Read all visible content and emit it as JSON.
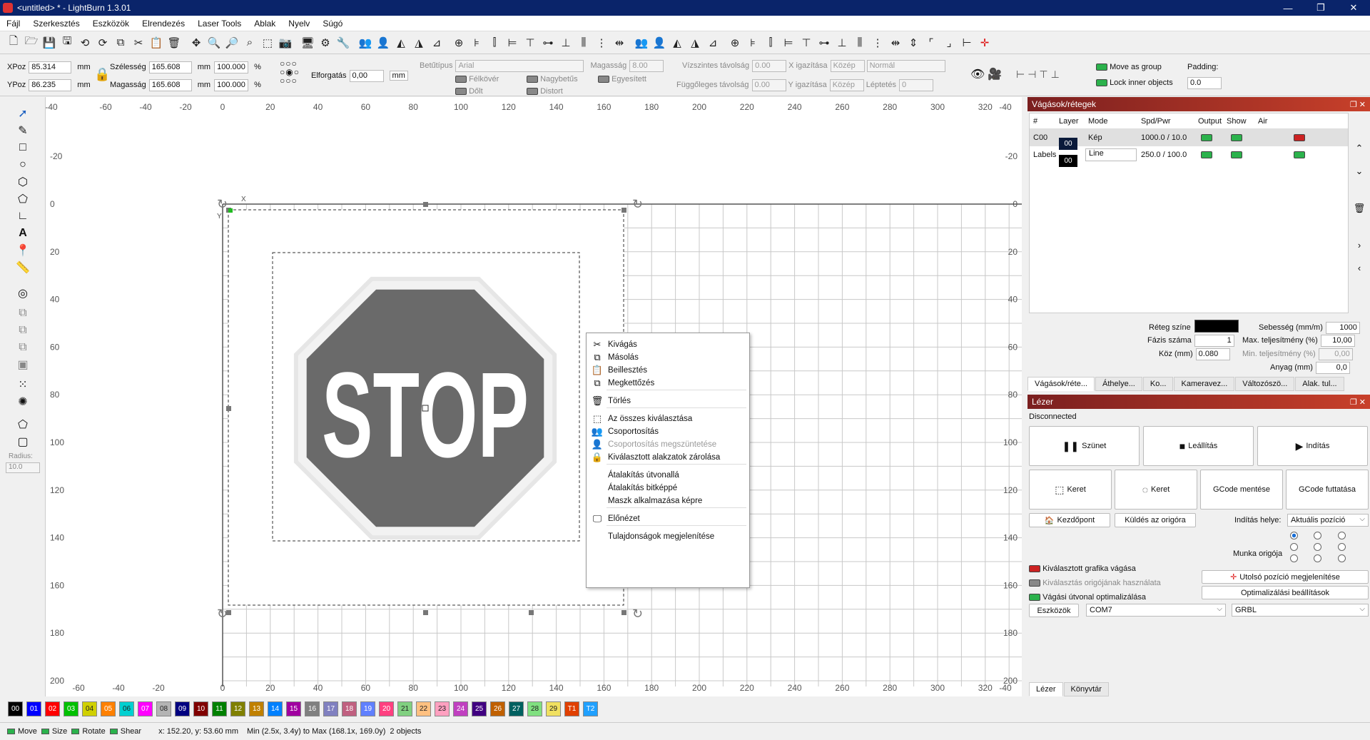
{
  "window": {
    "title": "<untitled> * - LightBurn 1.3.01"
  },
  "menu": [
    "Fájl",
    "Szerkesztés",
    "Eszközök",
    "Elrendezés",
    "Laser Tools",
    "Ablak",
    "Nyelv",
    "Súgó"
  ],
  "props": {
    "xpos_label": "XPoz",
    "xpos": "85.314",
    "ypos_label": "YPoz",
    "ypos": "86.235",
    "unit": "mm",
    "width_label": "Szélesség",
    "width": "165.608",
    "height_label": "Magasság",
    "height": "165.608",
    "scale_w": "100.000",
    "scale_h": "100.000",
    "pct": "%",
    "rotate_label": "Elforgatás",
    "rotate": "0,00",
    "rotate_unit": "mm",
    "font_label": "Betűtípus",
    "font": "Arial",
    "fheight_label": "Magasság",
    "fheight": "8.00",
    "bold": "Félkövér",
    "italic": "Dőlt",
    "upper": "Nagybetűs",
    "distort": "Distort",
    "weld": "Egyesített",
    "hspace_label": "Vízszintes távolság",
    "hspace": "0.00",
    "vspace_label": "Függőleges távolság",
    "vspace": "0.00",
    "xalign_label": "X igazítása",
    "xalign": "Közép",
    "yalign_label": "Y igazítása",
    "yalign": "Közép",
    "mode": "Normál",
    "step_label": "Léptetés",
    "step": "0",
    "move_group": "Move as group",
    "lock_inner": "Lock inner objects",
    "padding_label": "Padding:",
    "padding": "0.0"
  },
  "left_tools": {
    "radius_label": "Radius:",
    "radius": "10.0"
  },
  "canvas": {
    "ruler_top": [
      "-40",
      "-60",
      "-40",
      "-20",
      "0",
      "20",
      "40",
      "60",
      "80",
      "100",
      "120",
      "140",
      "160",
      "180",
      "200",
      "220",
      "240",
      "260",
      "280",
      "300",
      "320",
      "-40"
    ],
    "ruler_bottom": [
      "-60",
      "-40",
      "-20",
      "0",
      "20",
      "40",
      "60",
      "80",
      "100",
      "120",
      "140",
      "160",
      "180",
      "200",
      "220",
      "240",
      "260",
      "280",
      "300",
      "320",
      "-40"
    ],
    "ruler_left": [
      "-20",
      "0",
      "20",
      "40",
      "60",
      "80",
      "100",
      "120",
      "140",
      "160",
      "180",
      "200"
    ],
    "ruler_right": [
      "-20",
      "0",
      "20",
      "40",
      "60",
      "80",
      "100",
      "120",
      "140",
      "160",
      "180",
      "200"
    ],
    "axis_x": "X",
    "axis_y": "Y",
    "stop_text": "STOP"
  },
  "context_menu": [
    {
      "label": "Kivágás",
      "icon": "scissors-icon",
      "glyph": "✂",
      "enabled": true
    },
    {
      "label": "Másolás",
      "icon": "copy-icon",
      "glyph": "⧉",
      "enabled": true
    },
    {
      "label": "Beillesztés",
      "icon": "paste-icon",
      "glyph": "📋",
      "enabled": true
    },
    {
      "label": "Megkettőzés",
      "icon": "duplicate-icon",
      "glyph": "⧉",
      "enabled": true
    },
    {
      "label": "Törlés",
      "icon": "trash-icon",
      "glyph": "🗑",
      "enabled": true
    },
    {
      "label": "Az összes kiválasztása",
      "icon": "select-all-icon",
      "glyph": "⬚",
      "enabled": true
    },
    {
      "label": "Csoportosítás",
      "icon": "group-icon",
      "glyph": "👥",
      "enabled": true
    },
    {
      "label": "Csoportosítás megszüntetése",
      "icon": "ungroup-icon",
      "glyph": "👤",
      "enabled": false
    },
    {
      "label": "Kiválasztott alakzatok zárolása",
      "icon": "lock-icon",
      "glyph": "🔒",
      "enabled": true
    },
    {
      "label": "Átalakítás útvonallá",
      "icon": "",
      "glyph": "",
      "enabled": true
    },
    {
      "label": "Átalakítás bitképpé",
      "icon": "",
      "glyph": "",
      "enabled": true
    },
    {
      "label": "Maszk alkalmazása képre",
      "icon": "",
      "glyph": "",
      "enabled": true
    },
    {
      "label": "Előnézet",
      "icon": "preview-icon",
      "glyph": "🖵",
      "enabled": true
    },
    {
      "label": "Tulajdonságok megjelenítése",
      "icon": "",
      "glyph": "",
      "enabled": true
    }
  ],
  "layers_panel": {
    "title": "Vágások/rétegek",
    "headers": [
      "#",
      "Layer",
      "Mode",
      "Spd/Pwr",
      "Output",
      "Show",
      "Air"
    ],
    "rows": [
      {
        "num": "C00",
        "layer": "00",
        "mode": "Kép",
        "spdpwr": "1000.0 / 10.0",
        "color": "#0a1a3a"
      },
      {
        "num": "Labels",
        "layer": "00",
        "mode": "Line",
        "spdpwr": "250.0 / 100.0",
        "color": "#000000"
      }
    ],
    "layer_color_label": "Réteg színe",
    "passes_label": "Fázis száma",
    "passes": "1",
    "interval_label": "Köz (mm)",
    "interval": "0.080",
    "speed_label": "Sebesség (mm/m)",
    "speed": "1000",
    "maxpower_label": "Max. teljesítmény (%)",
    "maxpower": "10,00",
    "minpower_label": "Min. teljesítmény (%)",
    "minpower": "0,00",
    "material_label": "Anyag (mm)",
    "material": "0,0",
    "tabs": [
      "Vágások/réte...",
      "Áthelye...",
      "Ko...",
      "Kameravez...",
      "Változószö...",
      "Alak. tul..."
    ]
  },
  "laser_panel": {
    "title": "Lézer",
    "status": "Disconnected",
    "pause": "Szünet",
    "stop": "Leállítás",
    "start": "Indítás",
    "frame1": "Keret",
    "frame2": "Keret",
    "save_gcode": "GCode mentése",
    "run_gcode": "GCode futtatása",
    "home": "Kezdőpont",
    "goto_origin": "Küldés az origóra",
    "start_from_label": "Indítás helye:",
    "start_from": "Aktuális pozíció",
    "job_origin_label": "Munka origója",
    "cut_selected": "Kiválasztott grafika vágása",
    "use_origin": "Kiválasztás origójának használata",
    "optimize": "Vágási útvonal optimalizálása",
    "show_last": "Utolsó pozíció megjelenítése",
    "opt_settings": "Optimalizálási beállítások",
    "devices": "Eszközök",
    "port": "COM7",
    "firmware": "GRBL",
    "tabs": [
      "Lézer",
      "Könyvtár"
    ]
  },
  "palette": [
    {
      "n": "00",
      "c": "#000000"
    },
    {
      "n": "01",
      "c": "#0000ff"
    },
    {
      "n": "02",
      "c": "#ff0000"
    },
    {
      "n": "03",
      "c": "#00c000"
    },
    {
      "n": "04",
      "c": "#d0d000"
    },
    {
      "n": "05",
      "c": "#ff8000"
    },
    {
      "n": "06",
      "c": "#00d0d0"
    },
    {
      "n": "07",
      "c": "#ff00ff"
    },
    {
      "n": "08",
      "c": "#b4b4b4"
    },
    {
      "n": "09",
      "c": "#000080"
    },
    {
      "n": "10",
      "c": "#800000"
    },
    {
      "n": "11",
      "c": "#008000"
    },
    {
      "n": "12",
      "c": "#808000"
    },
    {
      "n": "13",
      "c": "#c08000"
    },
    {
      "n": "14",
      "c": "#0080ff"
    },
    {
      "n": "15",
      "c": "#a000a0"
    },
    {
      "n": "16",
      "c": "#808080"
    },
    {
      "n": "17",
      "c": "#8080c0"
    },
    {
      "n": "18",
      "c": "#c06080"
    },
    {
      "n": "19",
      "c": "#6080ff"
    },
    {
      "n": "20",
      "c": "#ff4080"
    },
    {
      "n": "21",
      "c": "#80d080"
    },
    {
      "n": "22",
      "c": "#ffc080"
    },
    {
      "n": "23",
      "c": "#ffa0c0"
    },
    {
      "n": "24",
      "c": "#c040c0"
    },
    {
      "n": "25",
      "c": "#400080"
    },
    {
      "n": "26",
      "c": "#c06000"
    },
    {
      "n": "27",
      "c": "#006060"
    },
    {
      "n": "28",
      "c": "#80e080"
    },
    {
      "n": "29",
      "c": "#f0e060"
    },
    {
      "n": "T1",
      "c": "#e04000"
    },
    {
      "n": "T2",
      "c": "#20a0ff"
    }
  ],
  "status": {
    "move": "Move",
    "size": "Size",
    "rotate": "Rotate",
    "shear": "Shear",
    "coords": "x: 152.20, y: 53.60 mm",
    "bounds": "Min (2.5x, 3.4y) to Max (168.1x, 169.0y)",
    "objects": "2 objects"
  }
}
